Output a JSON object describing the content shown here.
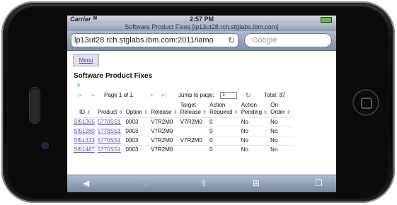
{
  "statusbar": {
    "carrier": "Carrier",
    "time": "2:57 PM"
  },
  "browser": {
    "title": "Software Product Fixes [lp13ut28.rch.stglabs.ibm.com]",
    "url": "lp13ut28.rch.stglabs.ibm.com:2011/iamo",
    "search_placeholder": "Google"
  },
  "page": {
    "menu_label": "Menu",
    "title": "Software Product Fixes"
  },
  "pager": {
    "page_label": "Page 1 of 1",
    "jump_label": "Jump to page:",
    "jump_value": "1",
    "total_label": "Total: 37"
  },
  "table": {
    "headers": {
      "id": "ID",
      "product": "Product",
      "option": "Option",
      "release": "Release",
      "target_top": "Target",
      "target_bottom": "Release",
      "action_req_top": "Action",
      "action_req_bottom": "Required",
      "action_pend_top": "Action",
      "action_pend_bottom": "Pending",
      "on_order_top": "On",
      "on_order_bottom": "Order"
    },
    "rows": [
      {
        "id": "SI51265",
        "product": "5770SS1",
        "option": "0003",
        "release": "V7R2M0",
        "target": "V7R2M0",
        "required": "0",
        "pending": "No",
        "order": "No"
      },
      {
        "id": "SI51280",
        "product": "5770SS1",
        "option": "0003",
        "release": "V7R2M0",
        "target": "",
        "required": "0",
        "pending": "No",
        "order": "No"
      },
      {
        "id": "SI51313",
        "product": "5770SS1",
        "option": "0003",
        "release": "V7R2M0",
        "target": "V7R2M0",
        "required": "0",
        "pending": "No",
        "order": "No"
      },
      {
        "id": "SI51487",
        "product": "5770SS1",
        "option": "0003",
        "release": "V7R2M0",
        "target": "",
        "required": "0",
        "pending": "No",
        "order": "No"
      }
    ]
  },
  "icons": {
    "wifi": "wifi-icon",
    "reload": "reload-icon",
    "back": "back-arrow-icon",
    "forward": "forward-arrow-icon",
    "share": "share-icon",
    "bookmarks": "bookmarks-icon",
    "pages": "pages-icon"
  },
  "colors": {
    "link": "#5a4fc0",
    "toolbar": "#7487a0"
  }
}
